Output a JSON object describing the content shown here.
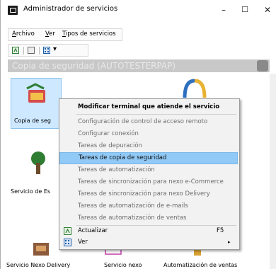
{
  "window": {
    "title": "Administrador de servicios",
    "controls": {
      "minimize": "–",
      "maximize": "☐",
      "close": "✕"
    }
  },
  "menubar": {
    "items": [
      "Archivo",
      "Ver",
      "Tipos de servicios"
    ]
  },
  "toolbar": {
    "dropdown_arrow": "▾"
  },
  "header": {
    "title": "Copia de seguridad (AUTOTESTERPAP)"
  },
  "tiles": [
    {
      "label": "Copia de seg",
      "selected": true
    },
    {
      "label": "Servicio de Es"
    },
    {
      "label": "Servicio Nexo Delivery"
    },
    {
      "label": "Servicio nexo"
    },
    {
      "label": "Automatización de ventas"
    }
  ],
  "context_menu": {
    "items": [
      {
        "label": "Modificar terminal que atiende el servicio",
        "style": "bold"
      },
      {
        "label": "Configuración de control de acceso remoto",
        "style": "disabled"
      },
      {
        "label": "Configurar conexión",
        "style": "disabled"
      },
      {
        "label": "Tareas de depuración",
        "style": "disabled"
      },
      {
        "label": "Tareas de copia de seguridad",
        "style": "highlighted"
      },
      {
        "label": "Tareas de automatización",
        "style": "disabled"
      },
      {
        "label": "Tareas de sincronización para nexo e-Commerce",
        "style": "disabled"
      },
      {
        "label": "Tareas de sincronización para nexo Delivery",
        "style": "disabled"
      },
      {
        "label": "Tareas de automatización de e-mails",
        "style": "disabled"
      },
      {
        "label": "Tareas de automatización de ventas",
        "style": "disabled"
      },
      {
        "label": "Actualizar",
        "style": "normal",
        "shortcut": "F5",
        "icon": "refresh-icon"
      },
      {
        "label": "Ver",
        "style": "normal",
        "submenu_arrow": "▸",
        "icon": "view-grid-icon"
      }
    ]
  }
}
